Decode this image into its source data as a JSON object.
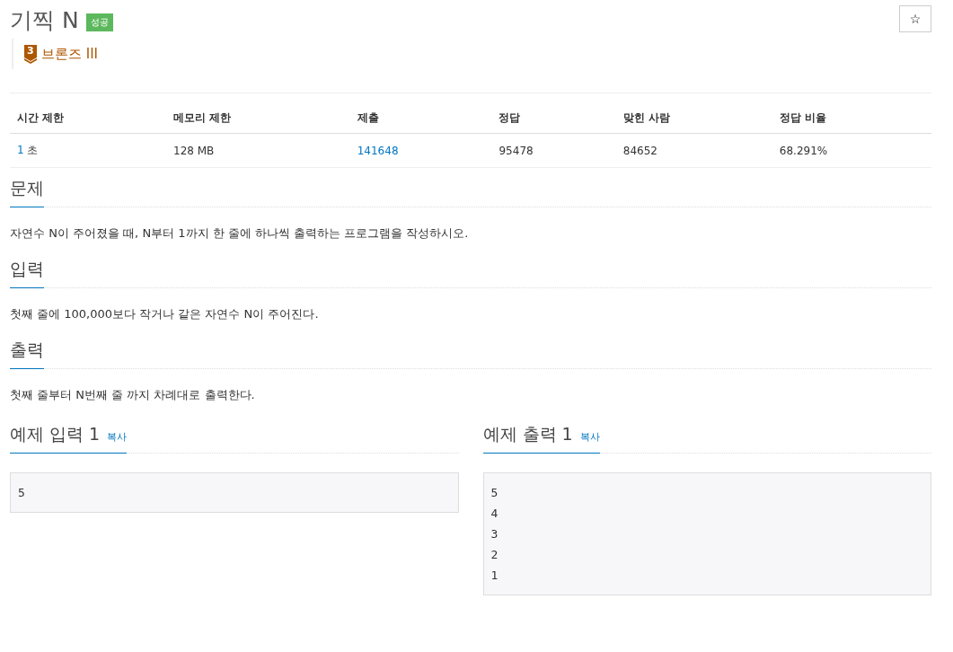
{
  "title": "기찍 N",
  "result_badge": "성공",
  "star_button": "☆",
  "tier": {
    "number": "3",
    "name": "브론즈 III"
  },
  "stats": {
    "columns": [
      "시간 제한",
      "메모리 제한",
      "제출",
      "정답",
      "맞힌 사람",
      "정답 비율"
    ],
    "cells": [
      {
        "parts": [
          {
            "text": "1",
            "link": true
          },
          {
            "text": " 초",
            "link": false
          }
        ]
      },
      {
        "parts": [
          {
            "text": "128 MB",
            "link": false
          }
        ]
      },
      {
        "parts": [
          {
            "text": "141648",
            "link": true
          }
        ]
      },
      {
        "parts": [
          {
            "text": "95478",
            "link": false
          }
        ]
      },
      {
        "parts": [
          {
            "text": "84652",
            "link": false
          }
        ]
      },
      {
        "parts": [
          {
            "text": "68.291%",
            "link": false
          }
        ]
      }
    ]
  },
  "sections": [
    {
      "heading": "문제",
      "body": "자연수 N이 주어졌을 때, N부터 1까지 한 줄에 하나씩 출력하는 프로그램을 작성하시오."
    },
    {
      "heading": "입력",
      "body": "첫째 줄에 100,000보다 작거나 같은 자연수 N이 주어진다."
    },
    {
      "heading": "출력",
      "body": "첫째 줄부터 N번째 줄 까지 차례대로 출력한다."
    }
  ],
  "samples": [
    {
      "heading": "예제 입력 1",
      "copy": "복사",
      "lines": [
        "5"
      ]
    },
    {
      "heading": "예제 출력 1",
      "copy": "복사",
      "lines": [
        "5",
        "4",
        "3",
        "2",
        "1"
      ]
    }
  ]
}
